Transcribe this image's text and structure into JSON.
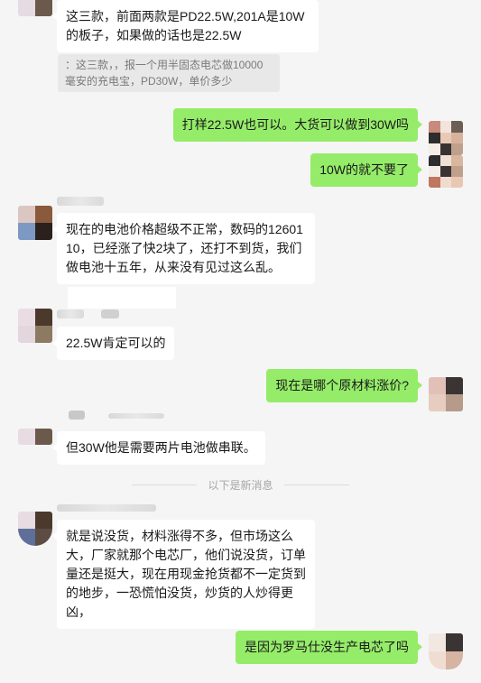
{
  "messages": [
    {
      "id": "m1",
      "text": "这三款，前面两款是PD22.5W,201A是10W的板子，如果做的话也是22.5W"
    },
    {
      "id": "m1_quote",
      "text": "：这三款，，报一个用半固态电芯做10000毫安的充电宝，PD30W，单价多少"
    },
    {
      "id": "m2",
      "text": "打样22.5W也可以。大货可以做到30W吗"
    },
    {
      "id": "m3",
      "text": "10W的就不要了"
    },
    {
      "id": "m4",
      "text": "现在的电池价格超级不正常，数码的1260110，已经涨了快2块了，还打不到货，我们做电池十五年，从来没有见过这么乱。"
    },
    {
      "id": "m5",
      "text": "22.5W肯定可以的"
    },
    {
      "id": "m6",
      "text": "现在是哪个原材料涨价?"
    },
    {
      "id": "m7",
      "text": "但30W他是需要两片电池做串联。"
    },
    {
      "id": "m8",
      "text": "就是说没货，材料涨得不多，但市场这么大，厂家就那个电芯厂，他们说没货，订单量还是挺大，现在用现金抢货都不一定货到的地步，一恐慌怕没货，炒货的人炒得更凶，"
    },
    {
      "id": "m9",
      "text": "是因为罗马仕没生产电芯了吗"
    }
  ],
  "divider": {
    "text": "以下是新消息"
  },
  "colors": {
    "background": "#f5f5f5",
    "bubble_in": "#ffffff",
    "bubble_out": "#95ec69"
  }
}
